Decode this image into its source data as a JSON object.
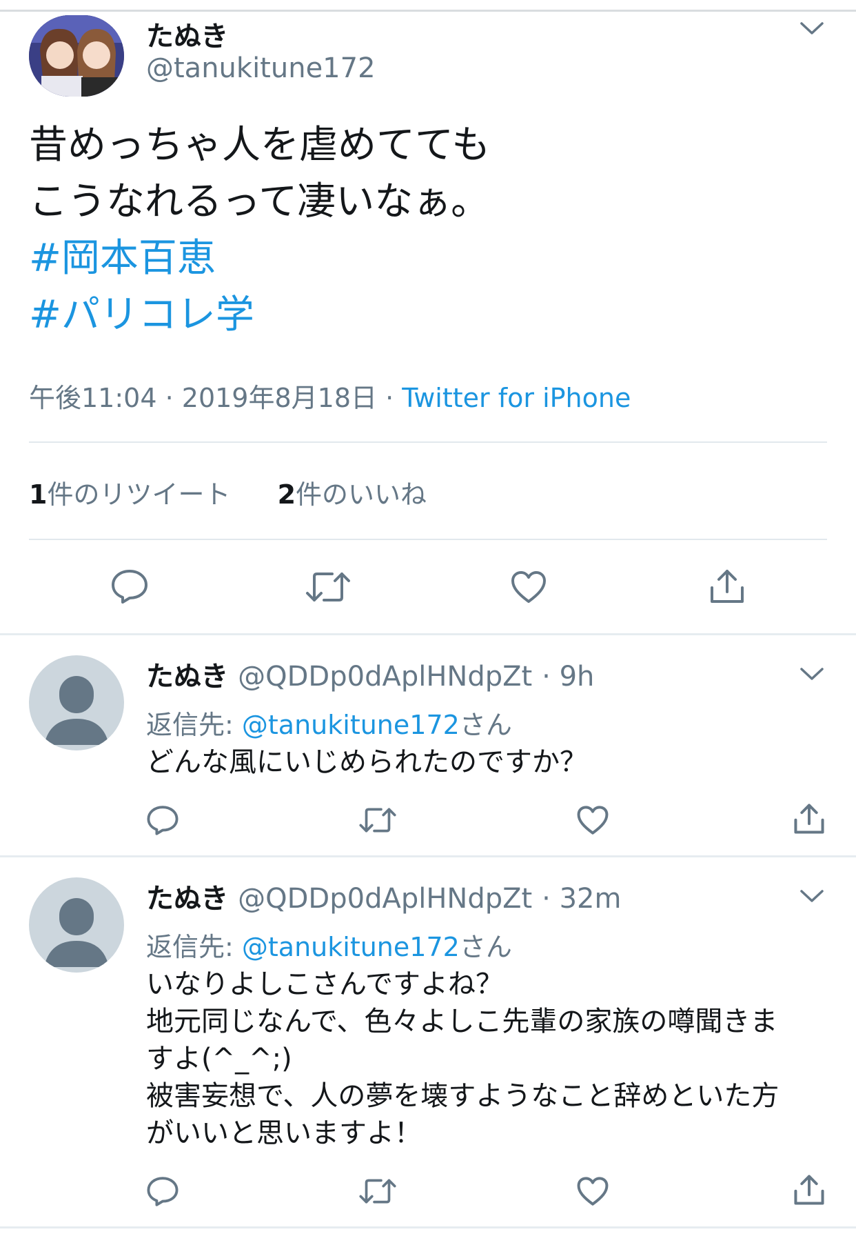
{
  "main_tweet": {
    "display_name": "たぬき",
    "handle": "@tanukitune172",
    "text_lines": [
      "昔めっちゃ人を虐めてても",
      "こうなれるって凄いなぁ。"
    ],
    "hashtags": [
      "#岡本百恵",
      "#パリコレ学"
    ],
    "time": "午後11:04",
    "date": "2019年8月18日",
    "source": "Twitter for iPhone",
    "retweet_count": "1",
    "retweet_label": "件のリツイート",
    "like_count": "2",
    "like_label": "件のいいね"
  },
  "replies": [
    {
      "display_name": "たぬき",
      "handle": "@QDDp0dAplHNdpZt",
      "time": "9h",
      "reply_prefix": "返信先:",
      "reply_to": "@tanukitune172",
      "reply_suffix": "さん",
      "body_lines": [
        "どんな風にいじめられたのですか？"
      ]
    },
    {
      "display_name": "たぬき",
      "handle": "@QDDp0dAplHNdpZt",
      "time": "32m",
      "reply_prefix": "返信先:",
      "reply_to": "@tanukitune172",
      "reply_suffix": "さん",
      "body_lines": [
        "いなりよしこさんですよね？",
        "地元同じなんで、色々よしこ先輩の家族の噂聞きま",
        "すよ(^_^;)",
        "被害妄想で、人の夢を壊すようなこと辞めといた方",
        "がいいと思いますよ！"
      ]
    }
  ],
  "icons": {
    "reply": "reply-icon",
    "retweet": "retweet-icon",
    "like": "heart-icon",
    "share": "share-icon",
    "menu": "chevron-down-icon"
  },
  "colors": {
    "link": "#1b95e0",
    "secondary_text": "#657786",
    "primary_text": "#14171a",
    "icon": "#657786",
    "divider": "#e6ecf0"
  }
}
